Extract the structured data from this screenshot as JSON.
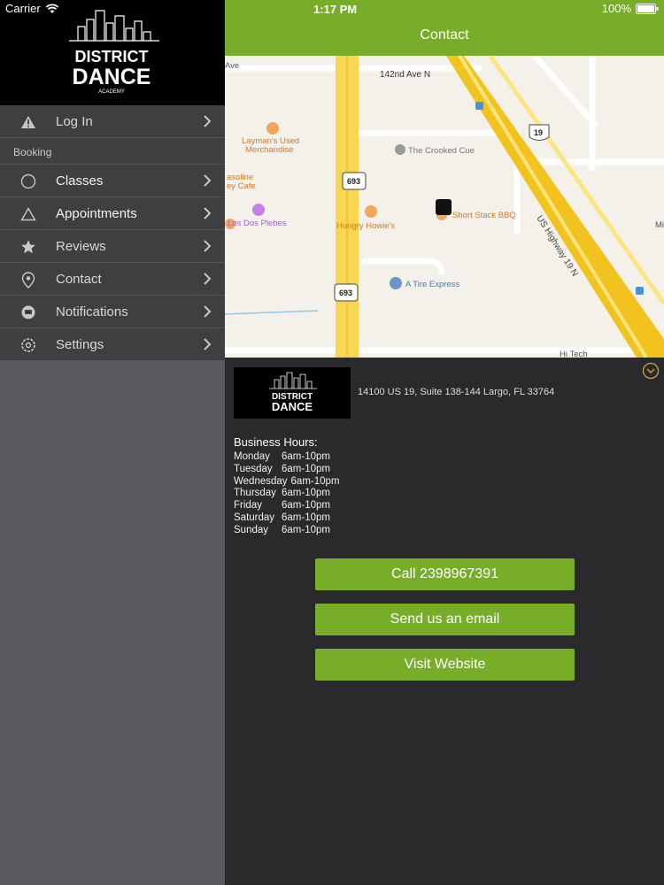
{
  "status_bar": {
    "carrier": "Carrier",
    "time": "1:17 PM",
    "battery": "100%"
  },
  "brand": {
    "line1": "DISTRICT",
    "line2": "DANCE",
    "line3": "ACADEMY"
  },
  "sidebar": {
    "login": {
      "label": "Log In",
      "icon": "warning-icon"
    },
    "section_label": "Booking",
    "items": [
      {
        "label": "Classes",
        "icon": "circle-icon"
      },
      {
        "label": "Appointments",
        "icon": "triangle-icon"
      },
      {
        "label": "Reviews",
        "icon": "star-icon"
      },
      {
        "label": "Contact",
        "icon": "location-pin-icon"
      },
      {
        "label": "Notifications",
        "icon": "chat-bubble-icon"
      },
      {
        "label": "Settings",
        "icon": "gear-icon"
      }
    ]
  },
  "header": {
    "title": "Contact"
  },
  "map": {
    "labels": {
      "ave": "Ave",
      "ave142": "142nd Ave N",
      "layman1": "Layman's Used",
      "layman2": "Merchandise",
      "gas1": "asoline",
      "gas2": "ey Cafe",
      "dos": "Los Dos Plebes",
      "crooked": "The Crooked Cue",
      "howie": "Hungry Howie's",
      "bbq": "Short Stack BBQ",
      "tire": "A Tire Express",
      "us19": "US Highway 19 N",
      "hitech": "Hi Tech",
      "r693a": "693",
      "r693b": "693",
      "r19": "19",
      "mi": "Mi"
    }
  },
  "info": {
    "address": "14100 US 19, Suite 138-144 Largo, FL 33764",
    "hours_title": "Business Hours:",
    "hours": [
      {
        "day": "Monday",
        "time": "6am-10pm"
      },
      {
        "day": "Tuesday",
        "time": "6am-10pm"
      },
      {
        "day": "Wednesday",
        "time": "6am-10pm"
      },
      {
        "day": "Thursday",
        "time": "6am-10pm"
      },
      {
        "day": "Friday",
        "time": "6am-10pm"
      },
      {
        "day": "Saturday",
        "time": "6am-10pm"
      },
      {
        "day": "Sunday",
        "time": "6am-10pm"
      }
    ],
    "buttons": {
      "call": "Call 2398967391",
      "email": "Send us an email",
      "website": "Visit Website"
    }
  },
  "colors": {
    "accent": "#78ad2a",
    "sidebar": "#3f3f42",
    "panel": "#2a2a2c"
  }
}
